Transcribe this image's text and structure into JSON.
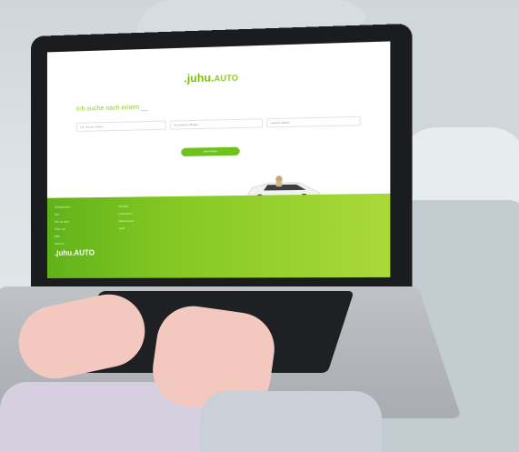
{
  "screen": {
    "logo_main": ".juhu.",
    "logo_suffix": "AUTO",
    "headline": "Ich suche nach einem __",
    "field_1": "z.B. Kombi, Cabrio",
    "field_2": "Monatliches Budget",
    "field_3": "Laufzeit wählen",
    "cta_label": "Jetzt finden",
    "footer_col1": [
      "Privatkunden",
      "Info",
      "Wie es geht",
      "Über uns",
      "Hilfe",
      "Karriere"
    ],
    "footer_col2": [
      "Kontakt",
      "Impressum",
      "Datenschutz",
      "AGB"
    ],
    "footer_logo": ".juhu.AUTO"
  },
  "colors": {
    "brand_green": "#7cc000",
    "footer_green_start": "#60b21a",
    "footer_green_end": "#a9d939"
  }
}
